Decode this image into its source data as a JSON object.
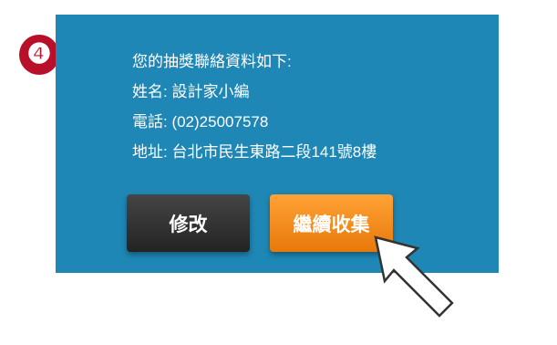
{
  "step": {
    "number": "❹",
    "color": "#b8102a"
  },
  "panel": {
    "background": "#1f87b5",
    "info": {
      "heading": "您的抽獎聯絡資料如下:",
      "name": "姓名: 設計家小編",
      "phone": "電話: (02)25007578",
      "address": "地址: 台北市民生東路二段141號8樓"
    }
  },
  "buttons": {
    "edit_label": "修改",
    "continue_label": "繼續收集"
  },
  "colors": {
    "edit_button": "#2c2c2c",
    "continue_button": "#f28a15"
  },
  "icons": {
    "cursor": "pointer-arrow-icon"
  }
}
